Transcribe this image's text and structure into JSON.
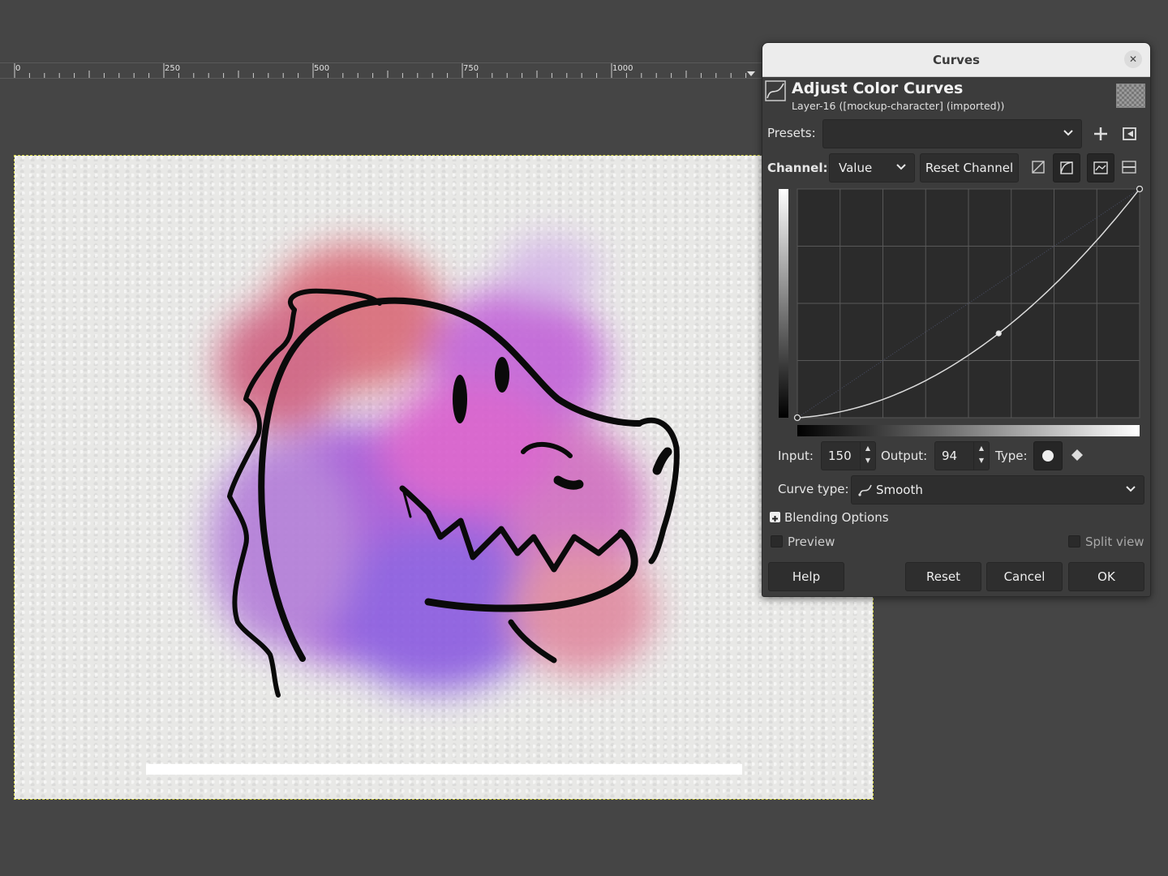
{
  "ruler": {
    "labels": [
      "0",
      "250",
      "500",
      "750",
      "1000"
    ]
  },
  "dialog": {
    "window_title": "Curves",
    "close_symbol": "✕",
    "heading": "Adjust Color Curves",
    "subheading": "Layer-16 ([mockup-character] (imported))",
    "presets_label": "Presets:",
    "presets_value": "",
    "channel_label": "Channel:",
    "channel_value": "Value",
    "reset_channel_label": "Reset Channel",
    "input_label": "Input:",
    "input_value": "150",
    "output_label": "Output:",
    "output_value": "94",
    "type_label": "Type:",
    "curve_type_label": "Curve type:",
    "curve_type_value": "Smooth",
    "blending_options_label": "Blending Options",
    "preview_label": "Preview",
    "split_view_label": "Split view",
    "help_label": "Help",
    "reset_label": "Reset",
    "cancel_label": "Cancel",
    "ok_label": "OK",
    "icons": [
      "curve-icon",
      "add-preset-icon",
      "manage-presets-icon",
      "linear-histogram-icon",
      "log-histogram-icon",
      "natural-curve-icon",
      "freehand-curve-icon",
      "smooth-point-icon",
      "corner-point-icon",
      "smooth-curve-icon"
    ],
    "preview_checked": false,
    "split_view_checked": false,
    "curve": {
      "control_points": [
        [
          0,
          0
        ],
        [
          150,
          94
        ],
        [
          255,
          255
        ]
      ]
    }
  }
}
